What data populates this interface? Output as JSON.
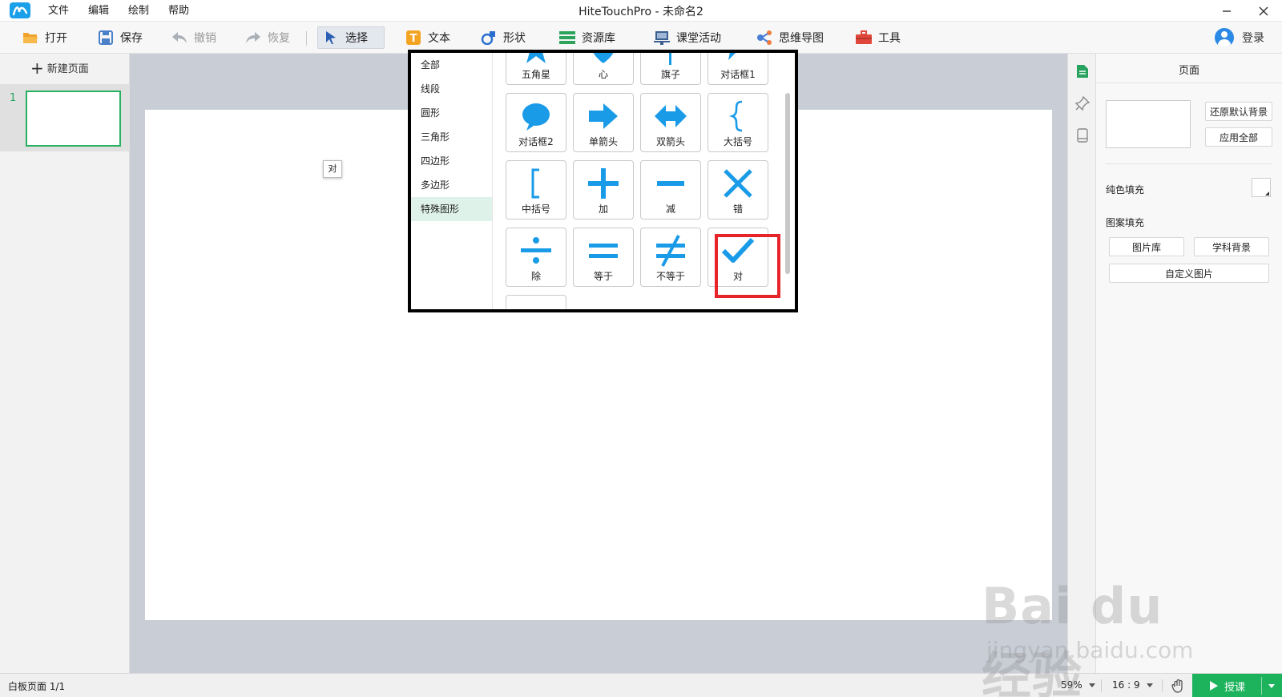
{
  "window": {
    "title": "HiteTouchPro - 未命名2",
    "menu": [
      "文件",
      "编辑",
      "绘制",
      "帮助"
    ]
  },
  "toolbar": {
    "open": "打开",
    "save": "保存",
    "undo": "撤销",
    "redo": "恢复",
    "select": "选择",
    "text": "文本",
    "shape": "形状",
    "resources": "资源库",
    "activity": "课堂活动",
    "mindmap": "思维导图",
    "tools": "工具",
    "login": "登录"
  },
  "left_panel": {
    "new_page": "新建页面",
    "pages": [
      {
        "number": "1"
      }
    ]
  },
  "shape_popup": {
    "categories": [
      "全部",
      "线段",
      "圆形",
      "三角形",
      "四边形",
      "多边形",
      "特殊图形"
    ],
    "active_category": "特殊图形",
    "shapes": [
      {
        "label": "五角星",
        "icon": "star-icon"
      },
      {
        "label": "心",
        "icon": "heart-icon"
      },
      {
        "label": "旗子",
        "icon": "flag-icon"
      },
      {
        "label": "对话框1",
        "icon": "speech-bubble-icon"
      },
      {
        "label": "对话框2",
        "icon": "speech-bubble-round-icon"
      },
      {
        "label": "单箭头",
        "icon": "arrow-right-icon"
      },
      {
        "label": "双箭头",
        "icon": "double-arrow-icon"
      },
      {
        "label": "大括号",
        "icon": "brace-icon"
      },
      {
        "label": "中括号",
        "icon": "bracket-icon"
      },
      {
        "label": "加",
        "icon": "plus-icon"
      },
      {
        "label": "减",
        "icon": "minus-icon"
      },
      {
        "label": "错",
        "icon": "cross-icon"
      },
      {
        "label": "除",
        "icon": "divide-icon"
      },
      {
        "label": "等于",
        "icon": "equals-icon"
      },
      {
        "label": "不等于",
        "icon": "not-equal-icon"
      },
      {
        "label": "对",
        "icon": "checkmark-icon"
      }
    ],
    "tooltip": "对",
    "shape_color": "#1a9be8"
  },
  "properties": {
    "title": "页面",
    "restore_bg": "还原默认背景",
    "apply_all": "应用全部",
    "solid_fill": "纯色填充",
    "pattern_fill": "图案填充",
    "gallery": "图片库",
    "subject_bg": "学科背景",
    "custom_image": "自定义图片"
  },
  "statusbar": {
    "page_status": "白板页面 1/1",
    "zoom": "59%",
    "ratio": "16 : 9",
    "teach": "授课"
  },
  "watermark": {
    "logo": "Bai du 经验",
    "url": "jingyan.baidu.com"
  },
  "colors": {
    "accent_green": "#1db35c",
    "shape_blue": "#1a9be8",
    "highlight_red": "#e8242b"
  }
}
